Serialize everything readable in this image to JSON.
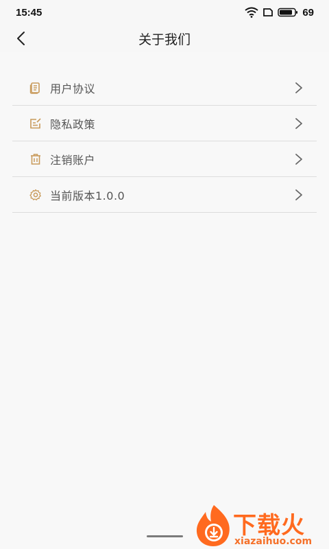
{
  "status": {
    "time": "15:45",
    "battery": "69"
  },
  "header": {
    "title": "关于我们"
  },
  "menu": {
    "items": [
      {
        "label": "用户协议",
        "icon": "document-icon"
      },
      {
        "label": "隐私政策",
        "icon": "edit-box-icon"
      },
      {
        "label": "注销账户",
        "icon": "trash-icon"
      },
      {
        "label": "当前版本1.0.0",
        "icon": "gear-icon"
      }
    ]
  },
  "watermark": {
    "title": "下载火",
    "subtitle": "xiazaihuo.com"
  },
  "colors": {
    "accent": "#c89a5a",
    "background": "#f8f8f8",
    "divider": "#dcdcdc",
    "watermark": "#ff6a1f"
  }
}
